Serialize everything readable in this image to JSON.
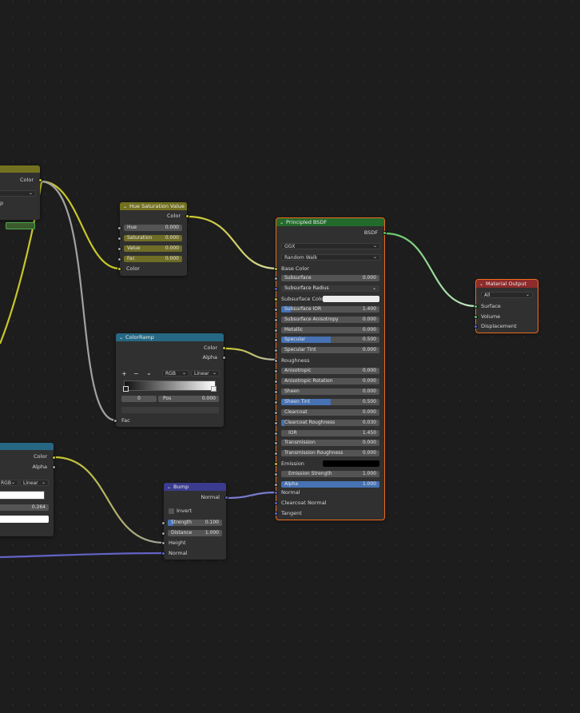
{
  "colors": {
    "bg": "#1d1d1d",
    "node_body": "#303030",
    "header_color": "#737120",
    "header_converter": "#266884",
    "header_shader": "#236b2c",
    "header_output": "#8e2b2b",
    "header_vector": "#3b3b8f",
    "socket_color": "#c7c729",
    "socket_float": "#a1a1a1",
    "socket_vector": "#6363c7",
    "socket_shader": "#63c763",
    "select_outline": "#ef6b1f",
    "slider_fill": "#4772b3"
  },
  "image_node": {
    "out_color": "Color"
  },
  "hsv": {
    "title": "Hue Saturation Value",
    "out_color": "Color",
    "hue_label": "Hue",
    "hue": "0.000",
    "sat_label": "Saturation",
    "sat": "0.000",
    "val_label": "Value",
    "val": "0.000",
    "fac_label": "Fac",
    "fac": "0.000",
    "in_color": "Color"
  },
  "colorramp": {
    "title": "ColorRamp",
    "out_color": "Color",
    "out_alpha": "Alpha",
    "add": "+",
    "remove": "−",
    "menu": "⌄",
    "mode": "RGB",
    "interp": "Linear",
    "index": "0",
    "pos_label": "Pos",
    "pos": "0.000",
    "in_fac": "Fac"
  },
  "bsdf": {
    "title": "Principled BSDF",
    "out": "BSDF",
    "distribution": "GGX",
    "sss_method": "Random Walk",
    "base_color": "Base Color",
    "fields": [
      {
        "label": "Subsurface",
        "value": "0.000",
        "fill": 0
      },
      {
        "label": "Subsurface Radius",
        "value": "",
        "fill": 0
      },
      {
        "label": "Subsurface Color",
        "value": "",
        "fill": 0
      },
      {
        "label": "Subsurface IOR",
        "value": "1.400",
        "fill": 0.1
      },
      {
        "label": "Subsurface Anisotropy",
        "value": "0.000",
        "fill": 0
      },
      {
        "label": "Metallic",
        "value": "0.000",
        "fill": 0
      },
      {
        "label": "Specular",
        "value": "0.500",
        "fill": 0.5
      },
      {
        "label": "Specular Tint",
        "value": "0.000",
        "fill": 0
      },
      {
        "label": "Roughness",
        "value": "",
        "fill": 0
      },
      {
        "label": "Anisotropic",
        "value": "0.000",
        "fill": 0
      },
      {
        "label": "Anisotropic Rotation",
        "value": "0.000",
        "fill": 0
      },
      {
        "label": "Sheen",
        "value": "0.000",
        "fill": 0
      },
      {
        "label": "Sheen Tint",
        "value": "0.500",
        "fill": 0.5
      },
      {
        "label": "Clearcoat",
        "value": "0.000",
        "fill": 0
      },
      {
        "label": "Clearcoat Roughness",
        "value": "0.030",
        "fill": 0.03
      },
      {
        "label": "IOR",
        "value": "1.450",
        "fill": 0
      },
      {
        "label": "Transmission",
        "value": "0.000",
        "fill": 0
      },
      {
        "label": "Transmission Roughness",
        "value": "0.000",
        "fill": 0
      },
      {
        "label": "Emission",
        "value": "",
        "fill": 0
      },
      {
        "label": "Emission Strength",
        "value": "1.000",
        "fill": 0
      },
      {
        "label": "Alpha",
        "value": "1.000",
        "fill": 1
      }
    ],
    "normal": "Normal",
    "clearcoat_normal": "Clearcoat Normal",
    "tangent": "Tangent"
  },
  "matout": {
    "title": "Material Output",
    "target": "All",
    "surface": "Surface",
    "volume": "Volume",
    "displacement": "Displacement"
  },
  "bump": {
    "title": "Bump",
    "out_normal": "Normal",
    "invert": "Invert",
    "strength_label": "Strength",
    "strength": "0.100",
    "distance_label": "Distance",
    "distance": "1.000",
    "in_height": "Height",
    "in_normal": "Normal"
  },
  "ramp2": {
    "out_color": "Color",
    "out_alpha": "Alpha",
    "mode": "RGB",
    "interp": "Linear",
    "pos": "0.264"
  }
}
